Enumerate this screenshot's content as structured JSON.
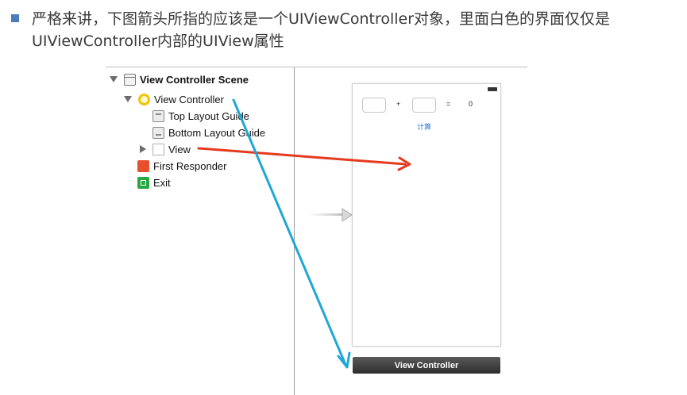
{
  "caption": {
    "text": "严格来讲，下图箭头所指的应该是一个UIViewController对象，里面白色的界面仅仅是UIViewController内部的UIView属性"
  },
  "outline": {
    "scene_label": "View Controller Scene",
    "view_controller_label": "View Controller",
    "top_layout_guide_label": "Top Layout Guide",
    "bottom_layout_guide_label": "Bottom Layout Guide",
    "view_label": "View",
    "first_responder_label": "First Responder",
    "exit_label": "Exit"
  },
  "canvas": {
    "plus_label": "+",
    "equals_label": "=",
    "result_value": "0",
    "calc_button_label": "计算",
    "bottom_bar_label": "View Controller"
  },
  "colors": {
    "red_arrow": "#e63a1e",
    "blue_arrow": "#1ea7d8",
    "bullet": "#4a7ebb",
    "link_blue": "#2f7ad6"
  },
  "icons": [
    "scene-icon",
    "view-controller-icon",
    "layout-guide-icon",
    "view-icon",
    "first-responder-icon",
    "exit-icon",
    "disclosure-triangle-icon",
    "battery-icon",
    "entry-point-arrow-icon"
  ]
}
